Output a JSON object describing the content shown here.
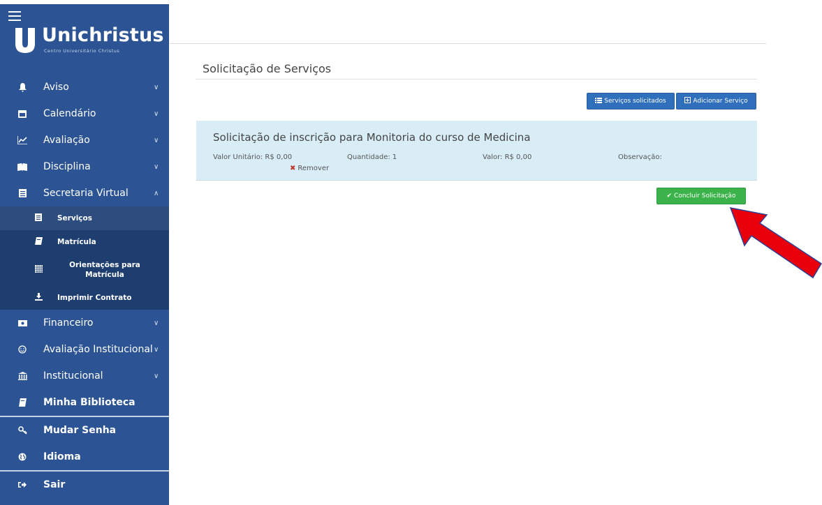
{
  "brand": {
    "name": "Unichristus",
    "subtitle": "Centro Universitário Christus"
  },
  "sidebar": {
    "items": [
      {
        "label": "Aviso",
        "icon": "bell-icon"
      },
      {
        "label": "Calendário",
        "icon": "calendar-icon"
      },
      {
        "label": "Avaliação",
        "icon": "chart-line-icon"
      },
      {
        "label": "Disciplina",
        "icon": "book-open-icon"
      },
      {
        "label": "Secretaria Virtual",
        "icon": "document-icon"
      }
    ],
    "submenu": [
      {
        "label": "Serviços",
        "icon": "document-icon"
      },
      {
        "label": "Matrícula",
        "icon": "book-icon"
      },
      {
        "label": "Orientações para Matrícula",
        "icon": "calendar-grid-icon"
      },
      {
        "label": "Imprimir Contrato",
        "icon": "download-icon"
      }
    ],
    "items2": [
      {
        "label": "Financeiro",
        "icon": "money-icon"
      },
      {
        "label": "Avaliação Institucional",
        "icon": "smile-icon"
      },
      {
        "label": "Institucional",
        "icon": "institution-icon"
      },
      {
        "label": "Minha Biblioteca",
        "icon": "book-icon"
      }
    ],
    "account": [
      {
        "label": "Mudar Senha",
        "icon": "key-icon"
      },
      {
        "label": "Idioma",
        "icon": "globe-icon"
      }
    ],
    "logout": {
      "label": "Sair",
      "icon": "sign-out-icon"
    }
  },
  "main": {
    "title": "Solicitação de Serviços",
    "btn_requested": "Serviços solicitados",
    "btn_add": "Adicionar Serviço",
    "service": {
      "title": "Solicitação de inscrição para Monitoria do curso de Medicina",
      "unit_value": "Valor Unitário: R$ 0,00",
      "quantity": "Quantidade: 1",
      "value": "Valor: R$ 0,00",
      "observation": "Observação:",
      "remove": "Remover"
    },
    "btn_conclude": "Concluir Solicitação"
  },
  "colors": {
    "sidebar": "#2c5494",
    "submenu": "#1e3e70",
    "primary": "#2f6fbb",
    "success": "#3cb34a",
    "panel": "#d9edf7",
    "arrow": "#e8000b"
  }
}
